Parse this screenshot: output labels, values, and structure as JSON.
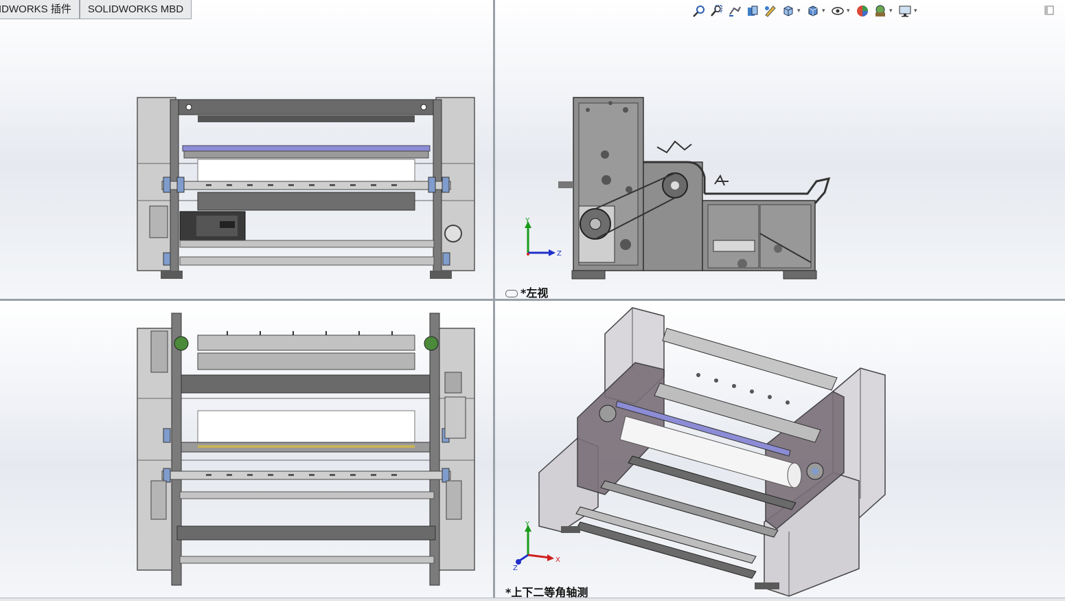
{
  "ribbon": {
    "tabs": [
      "IDWORKS 插件",
      "SOLIDWORKS MBD"
    ]
  },
  "heads_up_toolbar": {
    "icons": [
      "zoom-to-fit-icon",
      "zoom-to-area-icon",
      "previous-view-icon",
      "section-view-icon",
      "dynamic-annotation-icon",
      "view-orientation-icon",
      "display-style-icon",
      "hide-show-items-icon",
      "edit-appearance-icon",
      "apply-scene-icon",
      "view-settings-icon"
    ]
  },
  "viewports": {
    "top_right_label": "*左视",
    "bottom_right_label": "*上下二等角轴测"
  },
  "triad": {
    "side": {
      "axis_up": "Y",
      "axis_right": "Z"
    },
    "iso": {
      "axis_up": "Y",
      "axis_right": "X",
      "axis_diag": "Z"
    }
  },
  "colors": {
    "frame_dark": "#5c5c5c",
    "frame_mid": "#8d8d8d",
    "roller": "#bdbdbd",
    "glass": "#d9d6dc",
    "axis_y": "#1a9a1a",
    "axis_x": "#d02020",
    "axis_z": "#2030c8"
  }
}
